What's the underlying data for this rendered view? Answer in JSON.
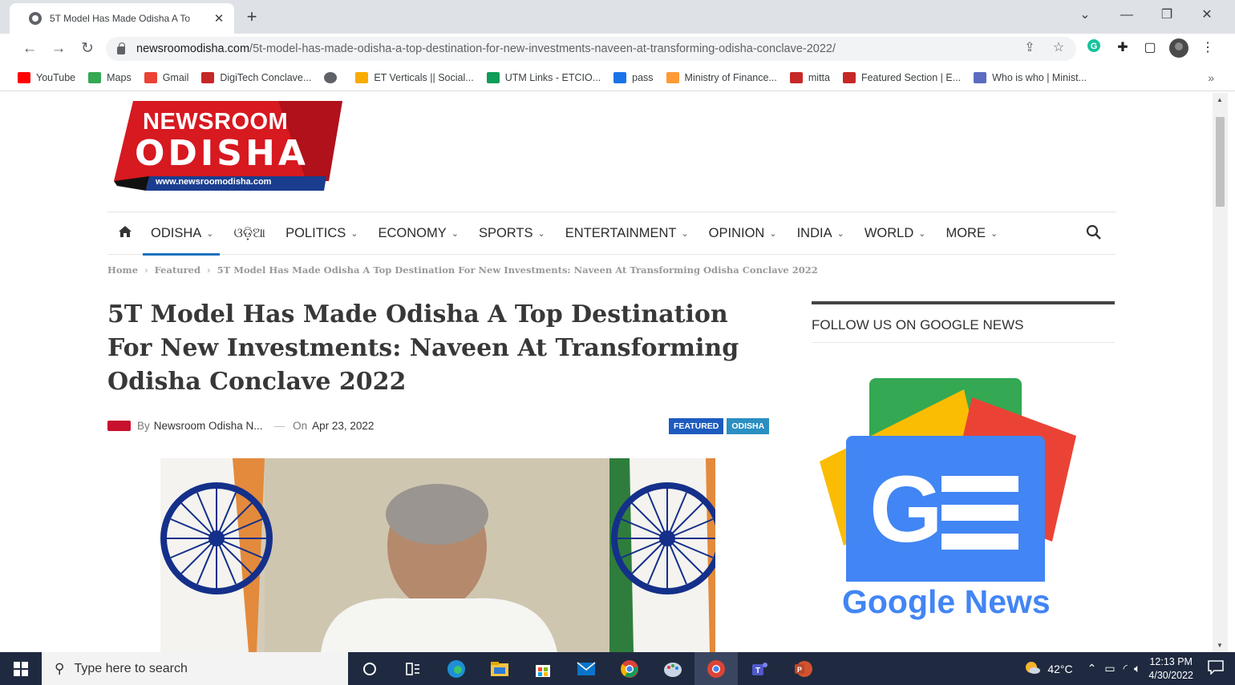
{
  "browser": {
    "tab_title": "5T Model Has Made Odisha A To",
    "tab_close": "✕",
    "new_tab": "+",
    "url_host": "newsroomodisha.com",
    "url_path": "/5t-model-has-made-odisha-a-top-destination-for-new-investments-naveen-at-transforming-odisha-conclave-2022/",
    "bookmarks": [
      {
        "label": "YouTube",
        "color": "#ff0000"
      },
      {
        "label": "Maps",
        "color": "#34a853"
      },
      {
        "label": "Gmail",
        "color": "#ea4335"
      },
      {
        "label": "DigiTech Conclave...",
        "color": "#c62828"
      },
      {
        "label": "",
        "color": "#5f6368"
      },
      {
        "label": "ET Verticals || Social...",
        "color": "#f9ab00"
      },
      {
        "label": "UTM Links - ETCIO...",
        "color": "#0f9d58"
      },
      {
        "label": "pass",
        "color": "#1a73e8"
      },
      {
        "label": "Ministry of Finance...",
        "color": "#ff9933"
      },
      {
        "label": "mitta",
        "color": "#c62828"
      },
      {
        "label": "Featured Section | E...",
        "color": "#c62828"
      },
      {
        "label": "Who is who | Minist...",
        "color": "#5c6bc0"
      }
    ],
    "bookmarks_more": "»"
  },
  "site": {
    "logo_line1": "NEWSROOM",
    "logo_line2": "ODISHA",
    "logo_url": "www.newsroomodisha.com",
    "nav": [
      {
        "label": "ODISHA",
        "caret": "⌄",
        "active": true
      },
      {
        "label": "ଓଡ଼ିଆ",
        "caret": ""
      },
      {
        "label": "POLITICS",
        "caret": "⌄"
      },
      {
        "label": "ECONOMY",
        "caret": "⌄"
      },
      {
        "label": "SPORTS",
        "caret": "⌄"
      },
      {
        "label": "ENTERTAINMENT",
        "caret": "⌄"
      },
      {
        "label": "OPINION",
        "caret": "⌄"
      },
      {
        "label": "INDIA",
        "caret": "⌄"
      },
      {
        "label": "WORLD",
        "caret": "⌄"
      },
      {
        "label": "MORE",
        "caret": "⌄"
      }
    ],
    "breadcrumb": {
      "home": "Home",
      "featured": "Featured",
      "current": "5T Model Has Made Odisha A Top Destination For New Investments: Naveen At Transforming Odisha Conclave 2022",
      "sep": "›"
    },
    "headline": "5T Model Has Made Odisha A Top Destination For New Investments: Naveen At Transforming Odisha Conclave 2022",
    "meta": {
      "by": "By",
      "author": "Newsroom Odisha N...",
      "on": "On",
      "date": "Apr 23, 2022"
    },
    "badges": [
      {
        "label": "FEATURED",
        "color": "#1e5bbf"
      },
      {
        "label": "ODISHA",
        "color": "#2a8fc1"
      }
    ],
    "sidebar_title": "FOLLOW US ON GOOGLE NEWS",
    "google_news": {
      "word1": "Google",
      "word2": "News"
    },
    "brand_red": "#d71920",
    "brand_blue": "#1e73be"
  },
  "taskbar": {
    "search_placeholder": "Type here to search",
    "temperature": "42°C",
    "time": "12:13 PM",
    "date": "4/30/2022"
  }
}
